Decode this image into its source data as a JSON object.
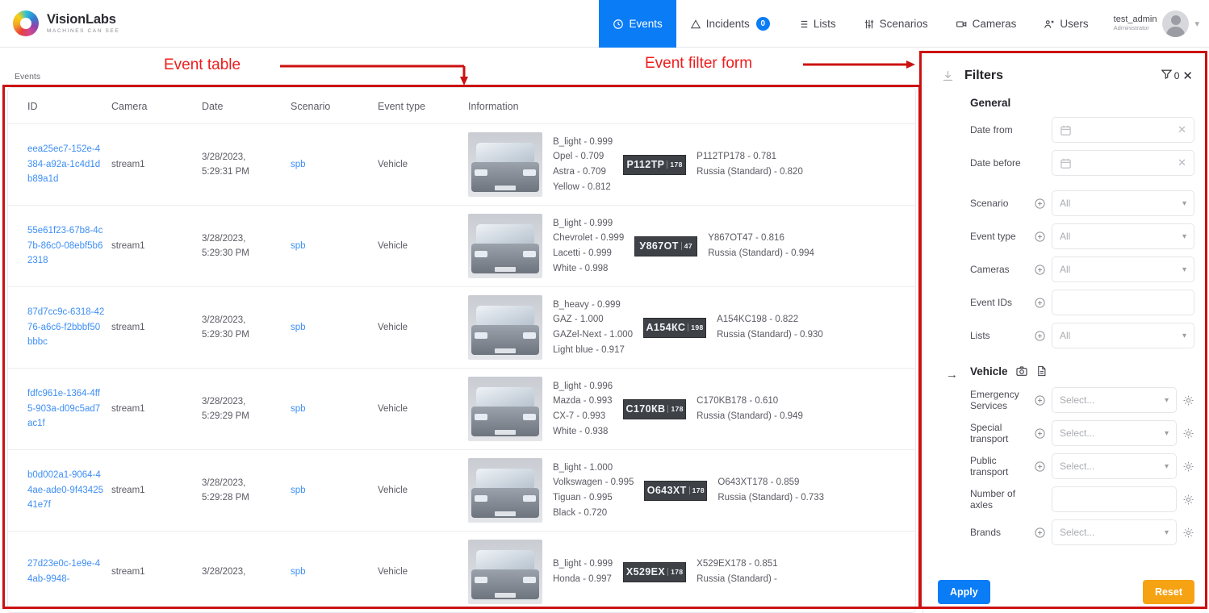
{
  "brand": {
    "name": "VisionLabs",
    "tagline": "MACHINES CAN SEE"
  },
  "nav": {
    "items": [
      {
        "label": "Events",
        "icon": "clock-icon",
        "active": true
      },
      {
        "label": "Incidents",
        "icon": "warning-triangle-icon",
        "badge": "0",
        "active": false
      },
      {
        "label": "Lists",
        "icon": "list-icon",
        "active": false
      },
      {
        "label": "Scenarios",
        "icon": "sliders-icon",
        "active": false
      },
      {
        "label": "Cameras",
        "icon": "camera-icon",
        "active": false
      },
      {
        "label": "Users",
        "icon": "users-icon",
        "active": false
      }
    ],
    "user": {
      "name": "test_admin",
      "role": "Administrator"
    }
  },
  "breadcrumb": "Events",
  "table": {
    "columns": [
      "ID",
      "Camera",
      "Date",
      "Scenario",
      "Event type",
      "Information"
    ],
    "rows": [
      {
        "id": "eea25ec7-152e-4384-a92a-1c4d1db89a1d",
        "camera": "stream1",
        "date": "3/28/2023, 5:29:31 PM",
        "scenario": "spb",
        "event_type": "Vehicle",
        "attributes": [
          "B_light - 0.999",
          "Opel - 0.709",
          "Astra - 0.709",
          "Yellow - 0.812"
        ],
        "plate_main": "Р112ТР",
        "plate_region": "178",
        "plate_info": [
          "P112TP178 - 0.781",
          "Russia (Standard) - 0.820"
        ]
      },
      {
        "id": "55e61f23-67b8-4c7b-86c0-08ebf5b62318",
        "camera": "stream1",
        "date": "3/28/2023, 5:29:30 PM",
        "scenario": "spb",
        "event_type": "Vehicle",
        "attributes": [
          "B_light - 0.999",
          "Chevrolet - 0.999",
          "Lacetti - 0.999",
          "White - 0.998"
        ],
        "plate_main": "У867ОТ",
        "plate_region": "47",
        "plate_info": [
          "Y867OT47 - 0.816",
          "Russia (Standard) - 0.994"
        ]
      },
      {
        "id": "87d7cc9c-6318-4276-a6c6-f2bbbf50bbbc",
        "camera": "stream1",
        "date": "3/28/2023, 5:29:30 PM",
        "scenario": "spb",
        "event_type": "Vehicle",
        "attributes": [
          "B_heavy - 0.999",
          "GAZ - 1.000",
          "GAZel-Next - 1.000",
          "Light blue - 0.917"
        ],
        "plate_main": "А154КС",
        "plate_region": "198",
        "plate_info": [
          "A154KC198 - 0.822",
          "Russia (Standard) - 0.930"
        ]
      },
      {
        "id": "fdfc961e-1364-4ff5-903a-d09c5ad7ac1f",
        "camera": "stream1",
        "date": "3/28/2023, 5:29:29 PM",
        "scenario": "spb",
        "event_type": "Vehicle",
        "attributes": [
          "B_light - 0.996",
          "Mazda - 0.993",
          "CX-7 - 0.993",
          "White - 0.938"
        ],
        "plate_main": "С170КВ",
        "plate_region": "178",
        "plate_info": [
          "C170KB178 - 0.610",
          "Russia (Standard) - 0.949"
        ]
      },
      {
        "id": "b0d002a1-9064-44ae-ade0-9f4342541e7f",
        "camera": "stream1",
        "date": "3/28/2023, 5:29:28 PM",
        "scenario": "spb",
        "event_type": "Vehicle",
        "attributes": [
          "B_light - 1.000",
          "Volkswagen - 0.995",
          "Tiguan - 0.995",
          "Black - 0.720"
        ],
        "plate_main": "О643ХТ",
        "plate_region": "178",
        "plate_info": [
          "O643XT178 - 0.859",
          "Russia (Standard) - 0.733"
        ]
      },
      {
        "id": "27d23e0c-1e9e-44ab-9948-",
        "camera": "stream1",
        "date": "3/28/2023,",
        "scenario": "spb",
        "event_type": "Vehicle",
        "attributes": [
          "B_light - 0.999",
          "Honda - 0.997"
        ],
        "plate_main": "Х529ЕХ",
        "plate_region": "178",
        "plate_info": [
          "X529EX178 - 0.851",
          "Russia (Standard) -"
        ]
      }
    ]
  },
  "filters": {
    "title": "Filters",
    "download_icon": "download-icon",
    "funnel_icon": "funnel-icon",
    "funnel_count": "0",
    "close_label": "✕",
    "general_section": "General",
    "vehicle_section": "Vehicle",
    "fields": {
      "date_from": {
        "label": "Date from",
        "value": "",
        "placeholder": ""
      },
      "date_before": {
        "label": "Date before",
        "value": "",
        "placeholder": ""
      },
      "scenario": {
        "label": "Scenario",
        "value": "All"
      },
      "event_type": {
        "label": "Event type",
        "value": "All"
      },
      "cameras": {
        "label": "Cameras",
        "value": "All"
      },
      "event_ids": {
        "label": "Event IDs",
        "value": ""
      },
      "lists": {
        "label": "Lists",
        "value": "All"
      },
      "emergency_services": {
        "label": "Emergency Services",
        "value": "Select..."
      },
      "special_transport": {
        "label": "Special transport",
        "value": "Select..."
      },
      "public_transport": {
        "label": "Public transport",
        "value": "Select..."
      },
      "number_of_axles": {
        "label": "Number of axles",
        "value": ""
      },
      "brands": {
        "label": "Brands",
        "value": "Select..."
      }
    },
    "apply_label": "Apply",
    "reset_label": "Reset"
  },
  "annotations": {
    "event_table_label": "Event table",
    "event_filter_label": "Event filter form",
    "color": "#ee1c1c"
  },
  "colors": {
    "accent_blue": "#0a7cf6",
    "link_blue": "#3d8ef5",
    "reset_orange": "#f5a313",
    "annotation_red": "#cc1111"
  }
}
